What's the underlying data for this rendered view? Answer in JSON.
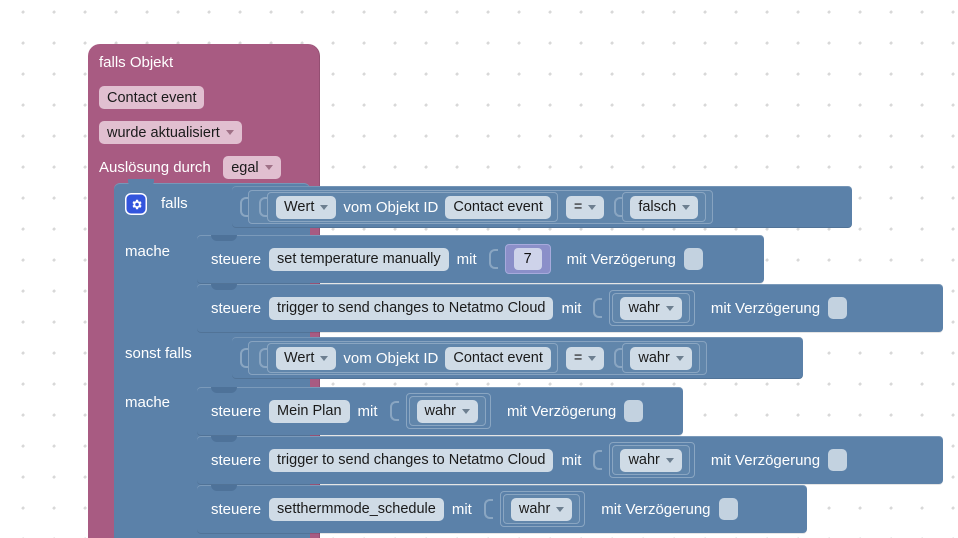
{
  "workspace": {
    "background_color": "#ffffff",
    "grid_dot_color": "#d8d8d8"
  },
  "event_block": {
    "color": "#a85b82",
    "title": "falls Objekt",
    "object_field": "Contact event",
    "state_dropdown": "wurde aktualisiert",
    "trigger_label": "Auslösung durch",
    "trigger_dropdown": "egal"
  },
  "controls_block": {
    "color": "#5b81a9",
    "gear_icon": "gear-icon",
    "if_label": "falls",
    "do_label_1": "mache",
    "elseif_label": "sonst falls",
    "do_label_2": "mache"
  },
  "condition_1": {
    "get_value": "Wert",
    "from_object_label": "vom Objekt ID",
    "object_id": "Contact event",
    "operator": "=",
    "compare_value": "falsch"
  },
  "condition_2": {
    "get_value": "Wert",
    "from_object_label": "vom Objekt ID",
    "object_id": "Contact event",
    "operator": "=",
    "compare_value": "wahr"
  },
  "statements": {
    "control_word": "steuere",
    "with_word": "mit",
    "delay_label": "mit Verzögerung",
    "then_branch": [
      {
        "target": "set temperature manually",
        "value": "7",
        "value_type": "number",
        "delay_checked": false
      },
      {
        "target": "trigger to send changes to Netatmo Cloud",
        "value": "wahr",
        "value_type": "boolean",
        "delay_checked": false
      }
    ],
    "else_branch": [
      {
        "target": "Mein Plan",
        "value": "wahr",
        "value_type": "boolean",
        "delay_checked": false
      },
      {
        "target": "trigger to send changes to Netatmo Cloud",
        "value": "wahr",
        "value_type": "boolean",
        "delay_checked": false
      },
      {
        "target": "setthermmode_schedule",
        "value": "wahr",
        "value_type": "boolean",
        "delay_checked": false
      }
    ]
  }
}
